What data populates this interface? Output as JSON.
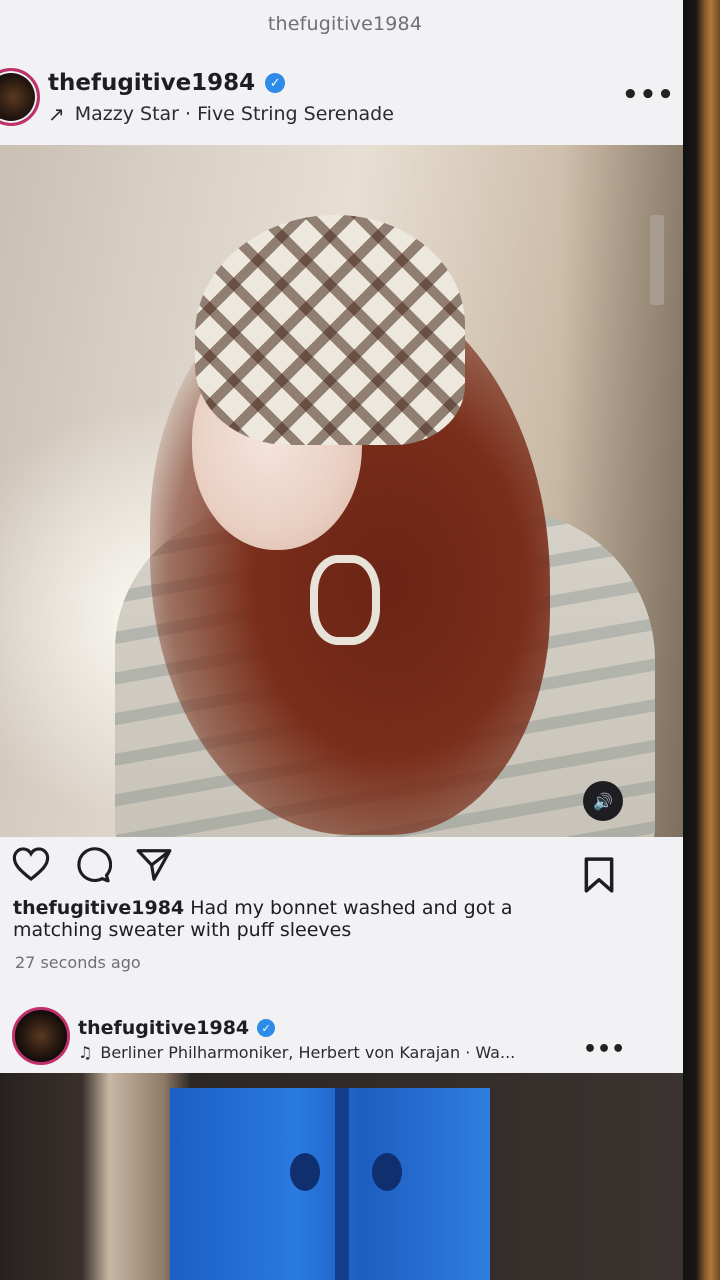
{
  "topbar": {
    "title": "thefugitive1984"
  },
  "post": {
    "username": "thefugitive1984",
    "verified": true,
    "audio": {
      "label": "Mazzy Star · Five String Serenade",
      "icon": "arrow-up-right-icon"
    },
    "more_icon": "more-horizontal-icon",
    "photo": {
      "sound_icon": "speaker-icon"
    },
    "actions": {
      "like_icon": "heart-icon",
      "comment_icon": "comment-icon",
      "share_icon": "send-icon",
      "save_icon": "bookmark-icon"
    },
    "caption": {
      "username": "thefugitive1984",
      "text": "Had my bonnet washed and got a matching sweater with puff sleeves"
    },
    "timestamp": "27 seconds ago"
  },
  "next_post": {
    "username": "thefugitive1984",
    "verified": true,
    "audio": {
      "label": "Berliner Philharmoniker, Herbert von Karajan · Wa...",
      "icon": "music-note-icon"
    },
    "more_icon": "more-horizontal-icon"
  },
  "colors": {
    "background": "#f2f1f4",
    "verified_blue": "#2f8be8",
    "story_ring": "#c0306a",
    "text_primary": "#1d1d22",
    "text_secondary": "#6f6f78"
  }
}
